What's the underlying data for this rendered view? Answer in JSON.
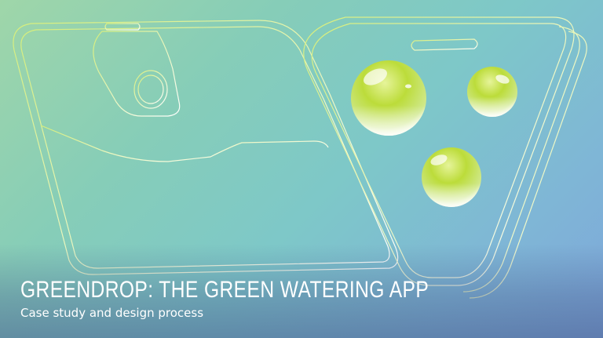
{
  "hero": {
    "title": "GREENDROP: THE GREEN WATERING APP",
    "subtitle": "Case study and design process"
  },
  "colors": {
    "background_start": "#9fd6a9",
    "background_end": "#7ea6da",
    "outline": "#e8f6d0",
    "drop_green": "#b9dc3c",
    "text": "#ffffff"
  },
  "icons": [
    "phone-outline-icon",
    "phone-outline-icon",
    "water-drop-icon",
    "water-drop-icon",
    "water-drop-icon"
  ]
}
